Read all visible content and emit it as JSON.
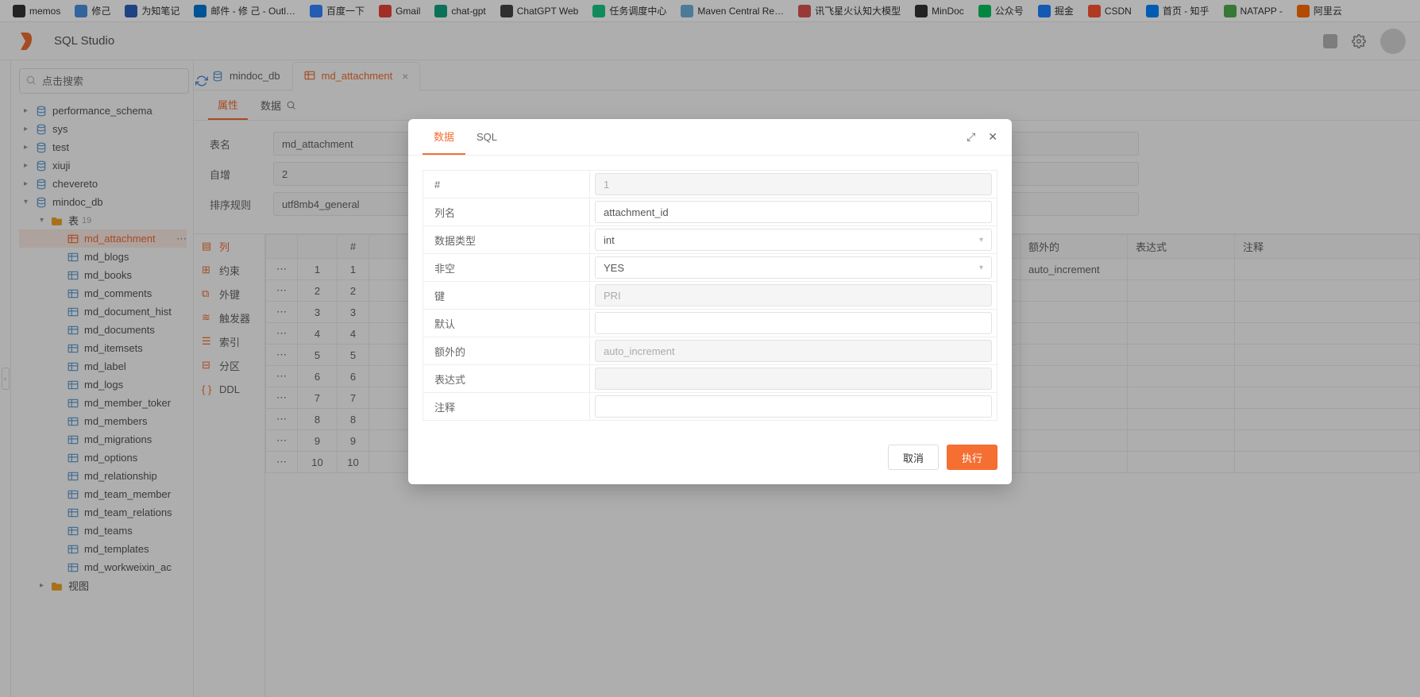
{
  "bookmarks": [
    {
      "label": "memos",
      "color": "#333"
    },
    {
      "label": "修己",
      "color": "#4a90e2"
    },
    {
      "label": "为知笔记",
      "color": "#2d5fbb"
    },
    {
      "label": "邮件 - 修 己 - Outl…",
      "color": "#0078d4"
    },
    {
      "label": "百度一下",
      "color": "#3385ff"
    },
    {
      "label": "Gmail",
      "color": "#ea4335"
    },
    {
      "label": "chat-gpt",
      "color": "#10a37f"
    },
    {
      "label": "ChatGPT Web",
      "color": "#444"
    },
    {
      "label": "任务调度中心",
      "color": "#18c984"
    },
    {
      "label": "Maven Central Re…",
      "color": "#6eb0dc"
    },
    {
      "label": "讯飞星火认知大模型",
      "color": "#d9534f"
    },
    {
      "label": "MinDoc",
      "color": "#333"
    },
    {
      "label": "公众号",
      "color": "#07c160"
    },
    {
      "label": "掘金",
      "color": "#1e80ff"
    },
    {
      "label": "CSDN",
      "color": "#fc5531"
    },
    {
      "label": "首页 - 知乎",
      "color": "#0084ff"
    },
    {
      "label": "NATAPP -",
      "color": "#4cae4c"
    },
    {
      "label": "阿里云",
      "color": "#ff6a00"
    }
  ],
  "header": {
    "title": "SQL Studio"
  },
  "search": {
    "placeholder": "点击搜索"
  },
  "databases": [
    {
      "name": "performance_schema"
    },
    {
      "name": "sys"
    },
    {
      "name": "test"
    },
    {
      "name": "xiuji"
    },
    {
      "name": "chevereto"
    }
  ],
  "currentDb": "mindoc_db",
  "tableGroup": {
    "label": "表",
    "count": "19"
  },
  "tables": [
    "md_attachment",
    "md_blogs",
    "md_books",
    "md_comments",
    "md_document_hist",
    "md_documents",
    "md_itemsets",
    "md_label",
    "md_logs",
    "md_member_toker",
    "md_members",
    "md_migrations",
    "md_options",
    "md_relationship",
    "md_team_member",
    "md_team_relations",
    "md_teams",
    "md_templates",
    "md_workweixin_ac"
  ],
  "viewGroup": "视图",
  "selectedTable": "md_attachment",
  "tabs": [
    {
      "label": "mindoc_db",
      "sel": false
    },
    {
      "label": "md_attachment",
      "sel": true
    }
  ],
  "subtabs": {
    "attrs": "属性",
    "data": "数据"
  },
  "form": {
    "tableName": {
      "label": "表名",
      "value": "md_attachment"
    },
    "autoInc": {
      "label": "自增",
      "value": "2"
    },
    "collation": {
      "label": "排序规则",
      "value": "utf8mb4_general"
    }
  },
  "gridSidebar": [
    "列",
    "约束",
    "外键",
    "触发器",
    "索引",
    "分区",
    "DDL"
  ],
  "gridHeaders": {
    "num": "#",
    "extra": "额外的",
    "expr": "表达式",
    "comment": "注释"
  },
  "gridRows": [
    1,
    2,
    3,
    4,
    5,
    6,
    7,
    8,
    9,
    10
  ],
  "gridExtraFirst": "auto_increment",
  "modal": {
    "tabs": {
      "data": "数据",
      "sql": "SQL"
    },
    "fields": {
      "index": {
        "label": "#",
        "value": "1",
        "disabled": true
      },
      "colname": {
        "label": "列名",
        "value": "attachment_id"
      },
      "datatype": {
        "label": "数据类型",
        "value": "int",
        "select": true
      },
      "notnull": {
        "label": "非空",
        "value": "YES",
        "select": true
      },
      "key": {
        "label": "键",
        "value": "PRI",
        "disabled": true
      },
      "default": {
        "label": "默认",
        "value": ""
      },
      "extra": {
        "label": "额外的",
        "value": "auto_increment",
        "disabled": true
      },
      "expr": {
        "label": "表达式",
        "value": "",
        "disabled": true
      },
      "comment": {
        "label": "注释",
        "value": ""
      }
    },
    "buttons": {
      "cancel": "取消",
      "ok": "执行"
    }
  }
}
